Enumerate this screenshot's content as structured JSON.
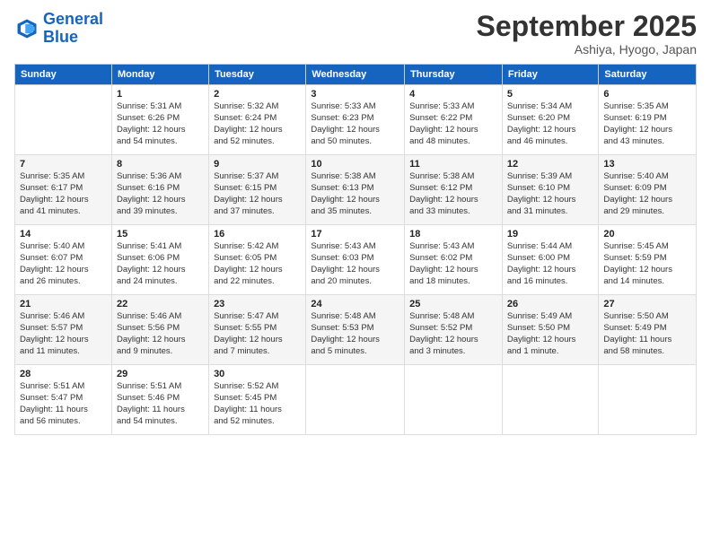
{
  "logo": {
    "line1": "General",
    "line2": "Blue"
  },
  "title": "September 2025",
  "subtitle": "Ashiya, Hyogo, Japan",
  "days_of_week": [
    "Sunday",
    "Monday",
    "Tuesday",
    "Wednesday",
    "Thursday",
    "Friday",
    "Saturday"
  ],
  "weeks": [
    [
      {
        "day": "",
        "info": ""
      },
      {
        "day": "1",
        "info": "Sunrise: 5:31 AM\nSunset: 6:26 PM\nDaylight: 12 hours\nand 54 minutes."
      },
      {
        "day": "2",
        "info": "Sunrise: 5:32 AM\nSunset: 6:24 PM\nDaylight: 12 hours\nand 52 minutes."
      },
      {
        "day": "3",
        "info": "Sunrise: 5:33 AM\nSunset: 6:23 PM\nDaylight: 12 hours\nand 50 minutes."
      },
      {
        "day": "4",
        "info": "Sunrise: 5:33 AM\nSunset: 6:22 PM\nDaylight: 12 hours\nand 48 minutes."
      },
      {
        "day": "5",
        "info": "Sunrise: 5:34 AM\nSunset: 6:20 PM\nDaylight: 12 hours\nand 46 minutes."
      },
      {
        "day": "6",
        "info": "Sunrise: 5:35 AM\nSunset: 6:19 PM\nDaylight: 12 hours\nand 43 minutes."
      }
    ],
    [
      {
        "day": "7",
        "info": "Sunrise: 5:35 AM\nSunset: 6:17 PM\nDaylight: 12 hours\nand 41 minutes."
      },
      {
        "day": "8",
        "info": "Sunrise: 5:36 AM\nSunset: 6:16 PM\nDaylight: 12 hours\nand 39 minutes."
      },
      {
        "day": "9",
        "info": "Sunrise: 5:37 AM\nSunset: 6:15 PM\nDaylight: 12 hours\nand 37 minutes."
      },
      {
        "day": "10",
        "info": "Sunrise: 5:38 AM\nSunset: 6:13 PM\nDaylight: 12 hours\nand 35 minutes."
      },
      {
        "day": "11",
        "info": "Sunrise: 5:38 AM\nSunset: 6:12 PM\nDaylight: 12 hours\nand 33 minutes."
      },
      {
        "day": "12",
        "info": "Sunrise: 5:39 AM\nSunset: 6:10 PM\nDaylight: 12 hours\nand 31 minutes."
      },
      {
        "day": "13",
        "info": "Sunrise: 5:40 AM\nSunset: 6:09 PM\nDaylight: 12 hours\nand 29 minutes."
      }
    ],
    [
      {
        "day": "14",
        "info": "Sunrise: 5:40 AM\nSunset: 6:07 PM\nDaylight: 12 hours\nand 26 minutes."
      },
      {
        "day": "15",
        "info": "Sunrise: 5:41 AM\nSunset: 6:06 PM\nDaylight: 12 hours\nand 24 minutes."
      },
      {
        "day": "16",
        "info": "Sunrise: 5:42 AM\nSunset: 6:05 PM\nDaylight: 12 hours\nand 22 minutes."
      },
      {
        "day": "17",
        "info": "Sunrise: 5:43 AM\nSunset: 6:03 PM\nDaylight: 12 hours\nand 20 minutes."
      },
      {
        "day": "18",
        "info": "Sunrise: 5:43 AM\nSunset: 6:02 PM\nDaylight: 12 hours\nand 18 minutes."
      },
      {
        "day": "19",
        "info": "Sunrise: 5:44 AM\nSunset: 6:00 PM\nDaylight: 12 hours\nand 16 minutes."
      },
      {
        "day": "20",
        "info": "Sunrise: 5:45 AM\nSunset: 5:59 PM\nDaylight: 12 hours\nand 14 minutes."
      }
    ],
    [
      {
        "day": "21",
        "info": "Sunrise: 5:46 AM\nSunset: 5:57 PM\nDaylight: 12 hours\nand 11 minutes."
      },
      {
        "day": "22",
        "info": "Sunrise: 5:46 AM\nSunset: 5:56 PM\nDaylight: 12 hours\nand 9 minutes."
      },
      {
        "day": "23",
        "info": "Sunrise: 5:47 AM\nSunset: 5:55 PM\nDaylight: 12 hours\nand 7 minutes."
      },
      {
        "day": "24",
        "info": "Sunrise: 5:48 AM\nSunset: 5:53 PM\nDaylight: 12 hours\nand 5 minutes."
      },
      {
        "day": "25",
        "info": "Sunrise: 5:48 AM\nSunset: 5:52 PM\nDaylight: 12 hours\nand 3 minutes."
      },
      {
        "day": "26",
        "info": "Sunrise: 5:49 AM\nSunset: 5:50 PM\nDaylight: 12 hours\nand 1 minute."
      },
      {
        "day": "27",
        "info": "Sunrise: 5:50 AM\nSunset: 5:49 PM\nDaylight: 11 hours\nand 58 minutes."
      }
    ],
    [
      {
        "day": "28",
        "info": "Sunrise: 5:51 AM\nSunset: 5:47 PM\nDaylight: 11 hours\nand 56 minutes."
      },
      {
        "day": "29",
        "info": "Sunrise: 5:51 AM\nSunset: 5:46 PM\nDaylight: 11 hours\nand 54 minutes."
      },
      {
        "day": "30",
        "info": "Sunrise: 5:52 AM\nSunset: 5:45 PM\nDaylight: 11 hours\nand 52 minutes."
      },
      {
        "day": "",
        "info": ""
      },
      {
        "day": "",
        "info": ""
      },
      {
        "day": "",
        "info": ""
      },
      {
        "day": "",
        "info": ""
      }
    ]
  ]
}
